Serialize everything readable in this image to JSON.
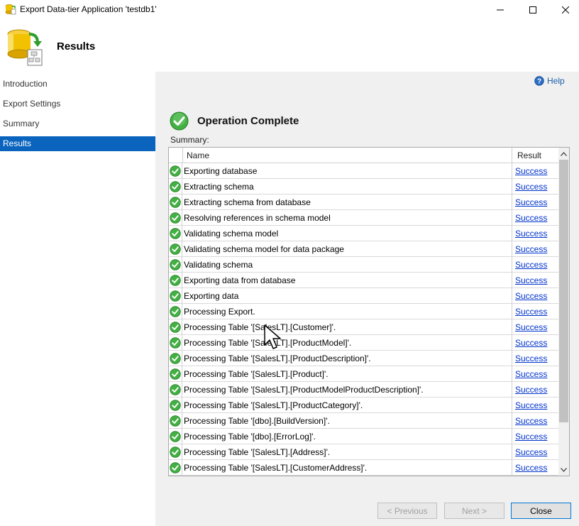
{
  "window": {
    "title": "Export Data-tier Application 'testdb1'",
    "app_icon": "database-export-icon"
  },
  "header": {
    "title": "Results",
    "icon": "database-export-wizard-icon"
  },
  "nav": {
    "items": [
      {
        "label": "Introduction",
        "selected": false
      },
      {
        "label": "Export Settings",
        "selected": false
      },
      {
        "label": "Summary",
        "selected": false
      },
      {
        "label": "Results",
        "selected": true
      }
    ]
  },
  "main": {
    "help_label": "Help",
    "status_title": "Operation Complete",
    "summary_label": "Summary:",
    "columns": {
      "name": "Name",
      "result": "Result"
    },
    "rows": [
      {
        "name": "Exporting database",
        "result": "Success"
      },
      {
        "name": "Extracting schema",
        "result": "Success"
      },
      {
        "name": "Extracting schema from database",
        "result": "Success"
      },
      {
        "name": "Resolving references in schema model",
        "result": "Success"
      },
      {
        "name": "Validating schema model",
        "result": "Success"
      },
      {
        "name": "Validating schema model for data package",
        "result": "Success"
      },
      {
        "name": "Validating schema",
        "result": "Success"
      },
      {
        "name": "Exporting data from database",
        "result": "Success"
      },
      {
        "name": "Exporting data",
        "result": "Success"
      },
      {
        "name": "Processing Export.",
        "result": "Success"
      },
      {
        "name": "Processing Table '[SalesLT].[Customer]'.",
        "result": "Success"
      },
      {
        "name": "Processing Table '[SalesLT].[ProductModel]'.",
        "result": "Success"
      },
      {
        "name": "Processing Table '[SalesLT].[ProductDescription]'.",
        "result": "Success"
      },
      {
        "name": "Processing Table '[SalesLT].[Product]'.",
        "result": "Success"
      },
      {
        "name": "Processing Table '[SalesLT].[ProductModelProductDescription]'.",
        "result": "Success"
      },
      {
        "name": "Processing Table '[SalesLT].[ProductCategory]'.",
        "result": "Success"
      },
      {
        "name": "Processing Table '[dbo].[BuildVersion]'.",
        "result": "Success"
      },
      {
        "name": "Processing Table '[dbo].[ErrorLog]'.",
        "result": "Success"
      },
      {
        "name": "Processing Table '[SalesLT].[Address]'.",
        "result": "Success"
      },
      {
        "name": "Processing Table '[SalesLT].[CustomerAddress]'.",
        "result": "Success"
      }
    ]
  },
  "buttons": {
    "previous": "< Previous",
    "next": "Next >",
    "close": "Close"
  },
  "colors": {
    "selection": "#0a64be",
    "link": "#0033cc",
    "success_green": "#3aa53a"
  }
}
